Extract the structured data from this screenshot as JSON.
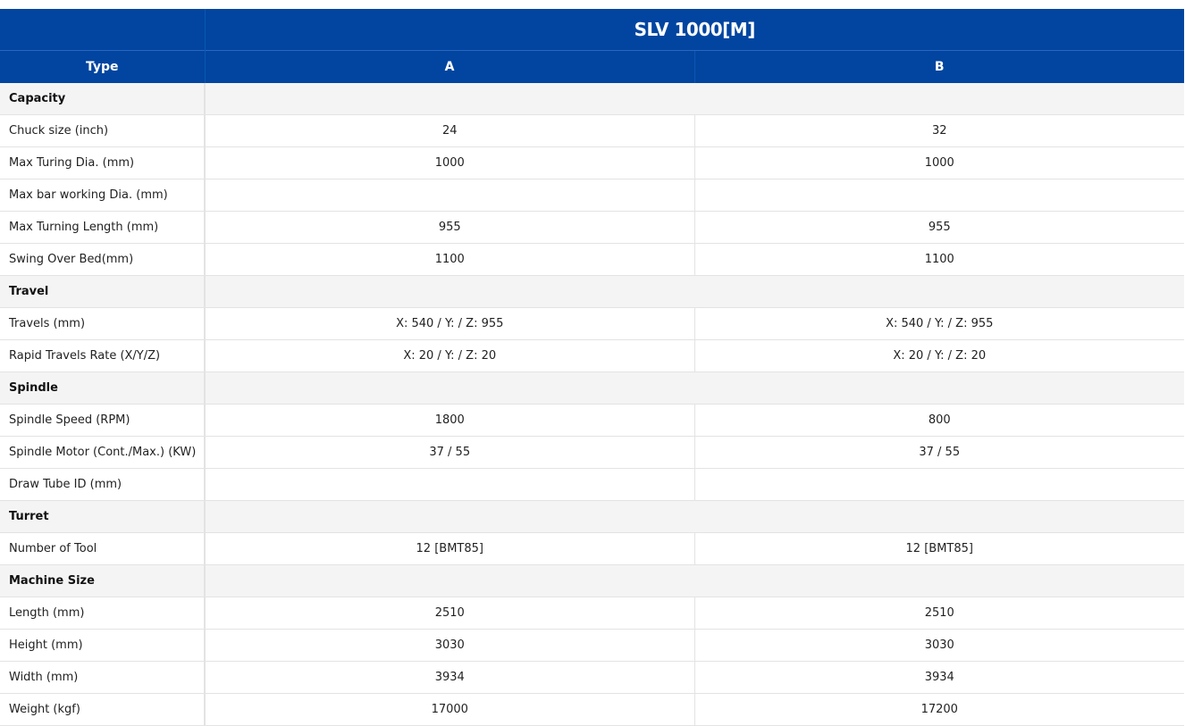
{
  "header": {
    "model": "SLV 1000[M]",
    "type_label": "Type",
    "col_a": "A",
    "col_b": "B"
  },
  "colors": {
    "header_bg": "#0145a0",
    "section_bg": "#f4f4f4"
  },
  "sections": [
    {
      "title": "Capacity",
      "rows": [
        {
          "label": "Chuck size (inch)",
          "a": "24",
          "b": "32"
        },
        {
          "label": "Max Turing Dia. (mm)",
          "a": "1000",
          "b": "1000"
        },
        {
          "label": "Max bar working Dia. (mm)",
          "a": "",
          "b": ""
        },
        {
          "label": "Max Turning Length (mm)",
          "a": "955",
          "b": "955"
        },
        {
          "label": "Swing Over Bed(mm)",
          "a": "1100",
          "b": "1100"
        }
      ]
    },
    {
      "title": "Travel",
      "rows": [
        {
          "label": "Travels (mm)",
          "a": "X: 540 / Y: / Z: 955",
          "b": "X: 540 / Y: / Z: 955"
        },
        {
          "label": "Rapid Travels Rate (X/Y/Z)",
          "a": "X: 20 / Y: / Z: 20",
          "b": "X: 20 / Y: / Z: 20"
        }
      ]
    },
    {
      "title": "Spindle",
      "rows": [
        {
          "label": "Spindle Speed (RPM)",
          "a": "1800",
          "b": "800"
        },
        {
          "label": "Spindle Motor (Cont./Max.) (KW)",
          "a": "37 / 55",
          "b": "37 / 55"
        },
        {
          "label": "Draw Tube ID (mm)",
          "a": "",
          "b": ""
        }
      ]
    },
    {
      "title": "Turret",
      "rows": [
        {
          "label": "Number of Tool",
          "a": "12 [BMT85]",
          "b": "12 [BMT85]"
        }
      ]
    },
    {
      "title": "Machine Size",
      "rows": [
        {
          "label": "Length (mm)",
          "a": "2510",
          "b": "2510"
        },
        {
          "label": "Height (mm)",
          "a": "3030",
          "b": "3030"
        },
        {
          "label": "Width (mm)",
          "a": "3934",
          "b": "3934"
        },
        {
          "label": "Weight (kgf)",
          "a": "17000",
          "b": "17200"
        }
      ]
    }
  ]
}
